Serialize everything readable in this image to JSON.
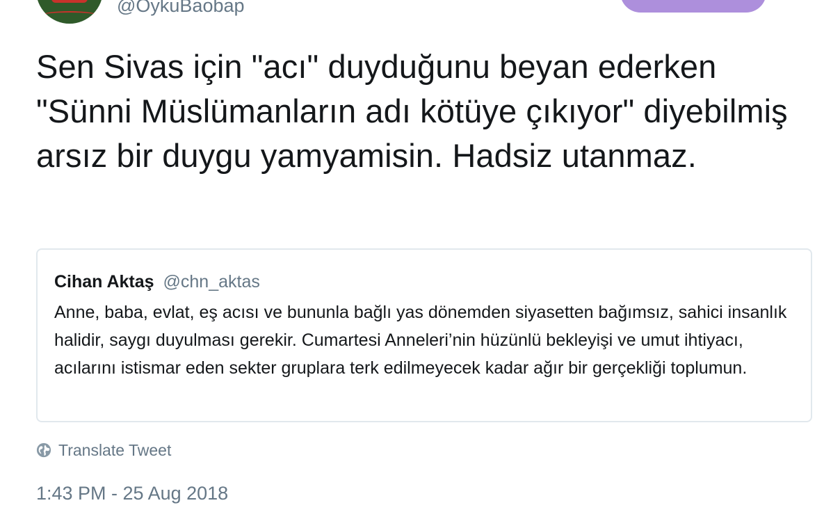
{
  "author": {
    "handle": "@OykuBaobap"
  },
  "tweet": {
    "text": "Sen Sivas için \"acı\" duyduğunu beyan ederken \"Sünni Müslümanların adı kötüye çıkıyor\" diyebilmiş arsız bir duygu yamyamisin. Hadsiz utanmaz."
  },
  "quoted_tweet": {
    "name": "Cihan Aktaş",
    "handle": "@chn_aktas",
    "text": "Anne, baba, evlat, eş acısı ve bununla bağlı yas dönemden siyasetten bağımsız, sahici insanlık halidir, saygı duyulması gerekir. Cumartesi Anneleri’nin hüzünlü bekleyişi ve umut ihtiyacı, acılarını istismar eden sekter gruplara terk edilmeyecek kadar ağır bir gerçekliği toplumun."
  },
  "translate": {
    "label": "Translate Tweet",
    "icon": "globe-icon"
  },
  "timestamp": "1:43 PM - 25 Aug 2018",
  "colors": {
    "text": "#14171a",
    "secondary": "#657786",
    "border": "#e1e8ed",
    "follow_button": "#ad8fdc"
  }
}
